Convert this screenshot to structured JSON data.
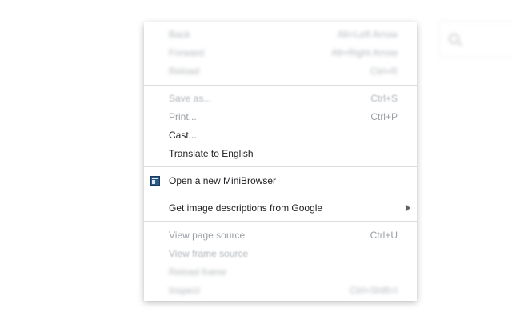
{
  "context_menu": {
    "back": {
      "label": "Back",
      "shortcut": "Alt+Left Arrow"
    },
    "forward": {
      "label": "Forward",
      "shortcut": "Alt+Right Arrow"
    },
    "reload": {
      "label": "Reload",
      "shortcut": "Ctrl+R"
    },
    "save_as": {
      "label": "Save as...",
      "shortcut": "Ctrl+S"
    },
    "print": {
      "label": "Print...",
      "shortcut": "Ctrl+P"
    },
    "cast": {
      "label": "Cast..."
    },
    "translate": {
      "label": "Translate to English"
    },
    "minibrowser": {
      "label": "Open a new MiniBrowser",
      "icon": "minibrowser-icon"
    },
    "image_descriptions": {
      "label": "Get image descriptions from Google",
      "icon": "submenu-arrow-icon"
    },
    "view_source": {
      "label": "View page source",
      "shortcut": "Ctrl+U"
    },
    "view_frame_source": {
      "label": "View frame source"
    },
    "reload_frame": {
      "label": "Reload frame"
    },
    "inspect": {
      "label": "Inspect",
      "shortcut": "Ctrl+Shift+I"
    }
  },
  "background": {
    "search_icon": "search-icon"
  }
}
